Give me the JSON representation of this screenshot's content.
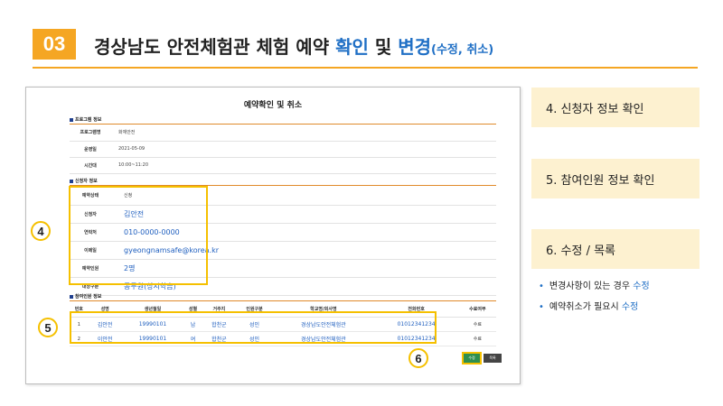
{
  "header": {
    "number": "03",
    "title_main": "경상남도 안전체험관 체험 예약 ",
    "title_hl1": "확인",
    "title_mid": " 및 ",
    "title_hl2": "변경",
    "title_small": "(수정, 취소)"
  },
  "screenshot": {
    "title": "예약확인 및 취소",
    "program_section": "프로그램 정보",
    "program_rows": [
      {
        "label": "프로그램명",
        "value": "화재안전"
      },
      {
        "label": "운영일",
        "value": "2021-05-09"
      },
      {
        "label": "시간대",
        "value": "10:00~11:20"
      }
    ],
    "applicant_section": "신청자 정보",
    "applicant_rows": [
      {
        "label": "예약상태",
        "value": "신청"
      },
      {
        "label": "신청자",
        "value": "김안전"
      },
      {
        "label": "연락처",
        "value": "010-0000-0000"
      },
      {
        "label": "이메일",
        "value": "gyeongnamsafe@korea.kr"
      },
      {
        "label": "예약인원",
        "value": "2명"
      },
      {
        "label": "대상구분",
        "value": "공무원(상시학습)"
      }
    ],
    "participant_section": "참여인원 정보",
    "participant_headers": [
      "번호",
      "성명",
      "생년월일",
      "성별",
      "거주지",
      "인원구분",
      "학교명/회사명",
      "전화번호",
      "수료여부"
    ],
    "participants": [
      [
        "1",
        "김안전",
        "19990101",
        "남",
        "합천군",
        "성인",
        "경상남도안전체험관",
        "01012341234",
        "수료"
      ],
      [
        "2",
        "이안전",
        "19990101",
        "여",
        "합천군",
        "성인",
        "경상남도안전체험관",
        "01012341234",
        "수료"
      ]
    ],
    "edit_button": "수정",
    "list_button": "목록"
  },
  "markers": {
    "m4": "4",
    "m5": "5",
    "m6": "6"
  },
  "steps": {
    "step4": "4. 신청자 정보 확인",
    "step5": "5. 참여인원 정보 확인",
    "step6": "6. 수정 / 목록"
  },
  "notes": {
    "note1_text": "변경사항이 있는 경우 ",
    "note1_hl": "수정",
    "note2_text": "예약취소가 필요시 ",
    "note2_hl": "수정"
  },
  "colors": {
    "accent": "#f5a623",
    "highlight": "#1f6fc5",
    "box": "#f5c000"
  }
}
